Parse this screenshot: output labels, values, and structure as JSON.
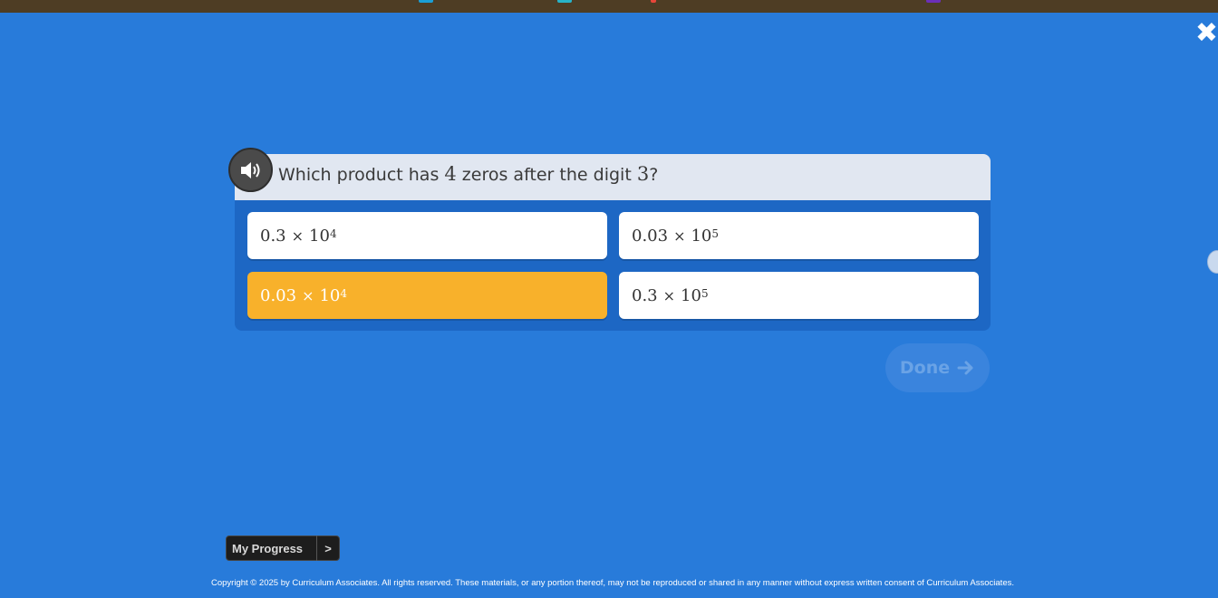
{
  "header": {
    "close_icon": "close-icon",
    "accent_colors": [
      "#1a9fd6",
      "#27b3c9",
      "#e8463a",
      "#6b2fb8"
    ]
  },
  "question": {
    "audio_icon": "speaker-icon",
    "text_before": "Which product has ",
    "num_zeros": "4",
    "text_middle": " zeros after the digit ",
    "digit": "3",
    "text_after": "?"
  },
  "choices": [
    {
      "coef": "0.3",
      "times": "×",
      "base": "10",
      "exp": "4",
      "selected": false
    },
    {
      "coef": "0.03",
      "times": "×",
      "base": "10",
      "exp": "5",
      "selected": false
    },
    {
      "coef": "0.03",
      "times": "×",
      "base": "10",
      "exp": "4",
      "selected": true
    },
    {
      "coef": "0.3",
      "times": "×",
      "base": "10",
      "exp": "5",
      "selected": false
    }
  ],
  "done": {
    "label": "Done",
    "icon": "arrow-right-icon"
  },
  "my_progress": {
    "label": "My Progress",
    "chevron": ">"
  },
  "footer": {
    "copyright": "Copyright © 2025 by Curriculum Associates. All rights reserved. These materials, or any portion thereof, may not be reproduced or shared in any manner without express written consent of Curriculum Associates."
  },
  "colors": {
    "background": "#287bda",
    "selected_choice": "#f8b12b",
    "prompt_bar": "#e1e7f1"
  }
}
